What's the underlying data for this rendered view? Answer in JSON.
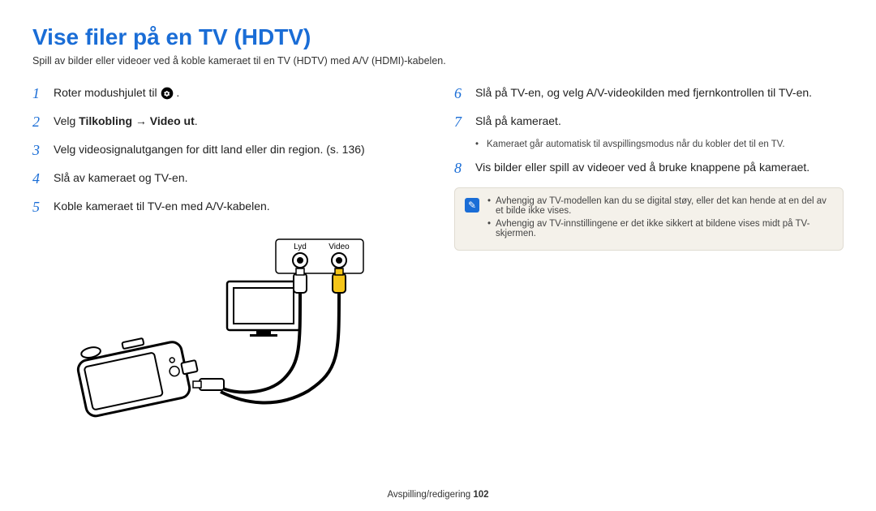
{
  "title": "Vise filer på en TV (HDTV)",
  "subtitle": "Spill av bilder eller videoer ved å koble kameraet til en TV (HDTV) med A/V (HDMI)-kabelen.",
  "left_steps": {
    "s1_pre": "Roter modushjulet til ",
    "s1_post": ".",
    "s2_pre": "Velg ",
    "s2_bold1": "Tilkobling",
    "s2_arrow": " → ",
    "s2_bold2": "Video ut",
    "s2_post": ".",
    "s3": "Velg videosignalutgangen for ditt land eller din region. (s. 136)",
    "s4": "Slå av kameraet og TV-en.",
    "s5": "Koble kameraet til TV-en med A/V-kabelen."
  },
  "diagram": {
    "lyd": "Lyd",
    "video": "Video"
  },
  "right_steps": {
    "s6": "Slå på TV-en, og velg A/V-videokilden med fjernkontrollen til TV-en.",
    "s7": "Slå på kameraet.",
    "s7_note": "Kameraet går automatisk til avspillingsmodus når du kobler det til en TV.",
    "s8": "Vis bilder eller spill av videoer ved å bruke knappene på kameraet."
  },
  "info": {
    "n1": "Avhengig av TV-modellen kan du se digital støy, eller det kan hende at en del av et bilde ikke vises.",
    "n2": "Avhengig av TV-innstillingene er det ikke sikkert at bildene vises midt på TV-skjermen."
  },
  "footer": {
    "section": "Avspilling/redigering  ",
    "page": "102"
  }
}
